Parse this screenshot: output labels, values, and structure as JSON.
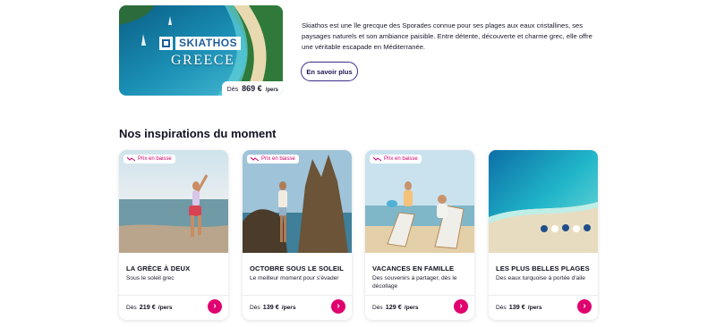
{
  "featured": {
    "logo": "SKIATHOS",
    "country": "GREECE",
    "price_prefix": "Dès",
    "price": "869 €",
    "price_unit": "/pers",
    "description": "Skiathos est une île grecque des Sporades connue pour ses plages aux eaux cristallines, ses paysages naturels et son ambiance paisible. Entre détente, découverte et charme grec, elle offre une véritable escapade en Méditerranée.",
    "more_label": "En savoir plus"
  },
  "section": {
    "title": "Nos inspirations du moment"
  },
  "cards": [
    {
      "badge": "Prix en baisse",
      "title": "LA GRÈCE À DEUX",
      "subtitle": "Sous le soleil grec",
      "price_prefix": "Dès",
      "price": "219 €",
      "price_unit": "/pers",
      "icon": "arrow-right-icon"
    },
    {
      "badge": "Prix en baisse",
      "title": "OCTOBRE SOUS LE SOLEIL",
      "subtitle": "Le meilleur moment pour s'évader",
      "price_prefix": "Dès",
      "price": "139 €",
      "price_unit": "/pers",
      "icon": "arrow-right-icon"
    },
    {
      "badge": "Prix en baisse",
      "title": "VACANCES EN FAMILLE",
      "subtitle": "Des souvenirs à partager, dès le décollage",
      "price_prefix": "Dès",
      "price": "129 €",
      "price_unit": "/pers",
      "icon": "arrow-right-icon"
    },
    {
      "title": "LES PLUS BELLES PLAGES",
      "subtitle": "Des eaux turquoise à portée d'aile",
      "price_prefix": "Dès",
      "price": "139 €",
      "price_unit": "/pers",
      "icon": "arrow-right-icon"
    }
  ],
  "colors": {
    "accent": "#e0006e",
    "button_border": "#3b2a8a",
    "text": "#1a1a2e"
  }
}
